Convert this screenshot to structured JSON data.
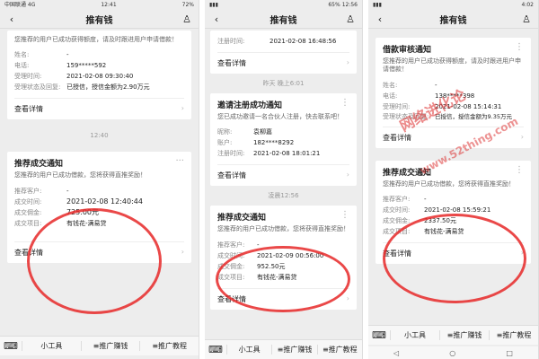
{
  "phone1": {
    "status_left": "中国联通 4G",
    "status_time": "12:41",
    "status_right": "72%",
    "title": "推有钱",
    "card_top": {
      "desc": "您推荐的用户已成功获得额度，请及时跟进用户申请借款！",
      "rows": [
        {
          "k": "姓名:",
          "v": "-"
        },
        {
          "k": "电话:",
          "v": "159*****592"
        },
        {
          "k": "受理时间:",
          "v": "2021-02-08 09:30:40"
        },
        {
          "k": "受理状态及回复:",
          "v": "已授信，授信金额为2.90万元"
        }
      ],
      "detail": "查看详情"
    },
    "time_label": "12:40",
    "card_bottom": {
      "title": "推荐成交通知",
      "desc": "您推荐的用户已成功借款，您将获得直推奖励！",
      "rows": [
        {
          "k": "推荐客户:",
          "v": "-"
        },
        {
          "k": "成交时间:",
          "v": "2021-02-08 12:40:44"
        },
        {
          "k": "成交佣金:",
          "v": "725.00元"
        },
        {
          "k": "成交项目:",
          "v": "有钱花-满易贷"
        }
      ],
      "detail": "查看详情"
    },
    "tabs": [
      "小工具",
      "≡推广赚钱",
      "≡推广教程"
    ]
  },
  "phone2": {
    "status_time": "12:56",
    "status_right": "65%",
    "title": "推有钱",
    "card_top": {
      "rows": [
        {
          "k": "注册时间:",
          "v": "2021-02-08 16:48:56"
        }
      ],
      "detail": "查看详情"
    },
    "time_a": "昨天 晚上6:01",
    "card_mid": {
      "title": "邀请注册成功通知",
      "desc": "您已成功邀请一名合伙人注册，快去联系吧！",
      "rows": [
        {
          "k": "昵称:",
          "v": "袁柳嘉"
        },
        {
          "k": "账户:",
          "v": "182****8292"
        },
        {
          "k": "注册时间:",
          "v": "2021-02-08 18:01:21"
        }
      ],
      "detail": "查看详情"
    },
    "time_b": "凌晨12:56",
    "card_bottom": {
      "title": "推荐成交通知",
      "desc": "您推荐的用户已成功借款，您将获得直推奖励！",
      "rows": [
        {
          "k": "推荐客户:",
          "v": "-"
        },
        {
          "k": "成交时间:",
          "v": "2021-02-09 00:56:00"
        },
        {
          "k": "成交佣金:",
          "v": "952.50元"
        },
        {
          "k": "成交项目:",
          "v": "有钱花-满易贷"
        }
      ],
      "detail": "查看详情"
    },
    "tabs": [
      "小工具",
      "≡推广赚钱",
      "≡推广教程"
    ]
  },
  "phone3": {
    "status_time": "4:02",
    "title": "推有钱",
    "card_top": {
      "title": "借款审核通知",
      "desc": "您推荐的用户已成功获得额度，请及时跟进用户申请借款！",
      "rows": [
        {
          "k": "姓名:",
          "v": "-"
        },
        {
          "k": "电话:",
          "v": "138*****398"
        },
        {
          "k": "受理时间:",
          "v": "2021-02-08 15:14:31"
        },
        {
          "k": "受理状态及回复:",
          "v": "已授信，授信金额为9.35万元"
        }
      ],
      "detail": "查看详情"
    },
    "card_bottom": {
      "title": "推荐成交通知",
      "desc": "您推荐的用户已成功借款，您将获得直推奖励！",
      "rows": [
        {
          "k": "推荐客户:",
          "v": "-"
        },
        {
          "k": "成交时间:",
          "v": "2021-02-08 15:59:21"
        },
        {
          "k": "成交佣金:",
          "v": "2337.50元"
        },
        {
          "k": "成交项目:",
          "v": "有钱花-满易贷"
        }
      ],
      "detail": "查看详情"
    },
    "tabs": [
      "小工具",
      "≡推广赚钱",
      "≡推广教程"
    ]
  },
  "watermark": {
    "line1": "网络进化论",
    "line2": "www.52thing.com"
  },
  "colors": {
    "circle": "#e62828",
    "bg": "#ededed"
  }
}
